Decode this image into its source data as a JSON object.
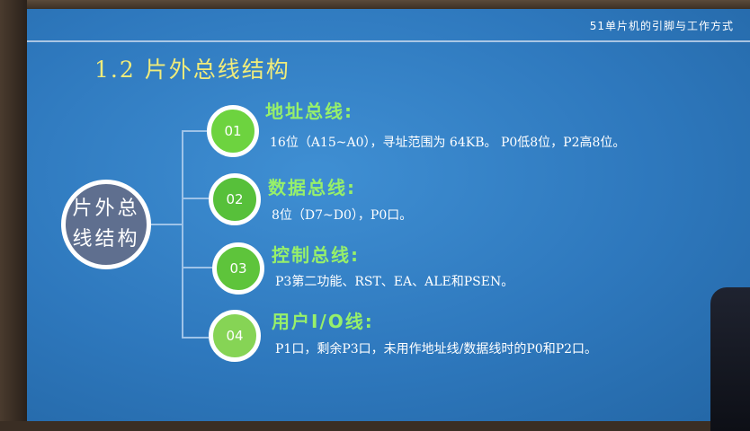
{
  "header": {
    "course_title": "51单片机的引脚与工作方式"
  },
  "section": {
    "title": "1.2 片外总线结构"
  },
  "center": {
    "line1": "片外总",
    "line2": "线结构"
  },
  "items": [
    {
      "number": "01",
      "title": "地址总线:",
      "desc": "16位（A15~A0），寻址范围为 64KB。 P0低8位，P2高8位。",
      "color": "#6dd33f"
    },
    {
      "number": "02",
      "title": "数据总线:",
      "desc": "8位（D7~D0），P0口。",
      "color": "#57c03a"
    },
    {
      "number": "03",
      "title": "控制总线:",
      "desc": "P3第二功能、RST、EA、ALE和PSEN。",
      "color": "#5ec43b"
    },
    {
      "number": "04",
      "title": "用户I/O线:",
      "desc": "P1口，剩余P3口，未用作地址线/数据线时的P0和P2口。",
      "color": "#86d455"
    }
  ],
  "colors": {
    "screen_bg": "#2e78bd",
    "title_yellow": "#f1ec7a",
    "item_title_green": "#97f06a"
  }
}
